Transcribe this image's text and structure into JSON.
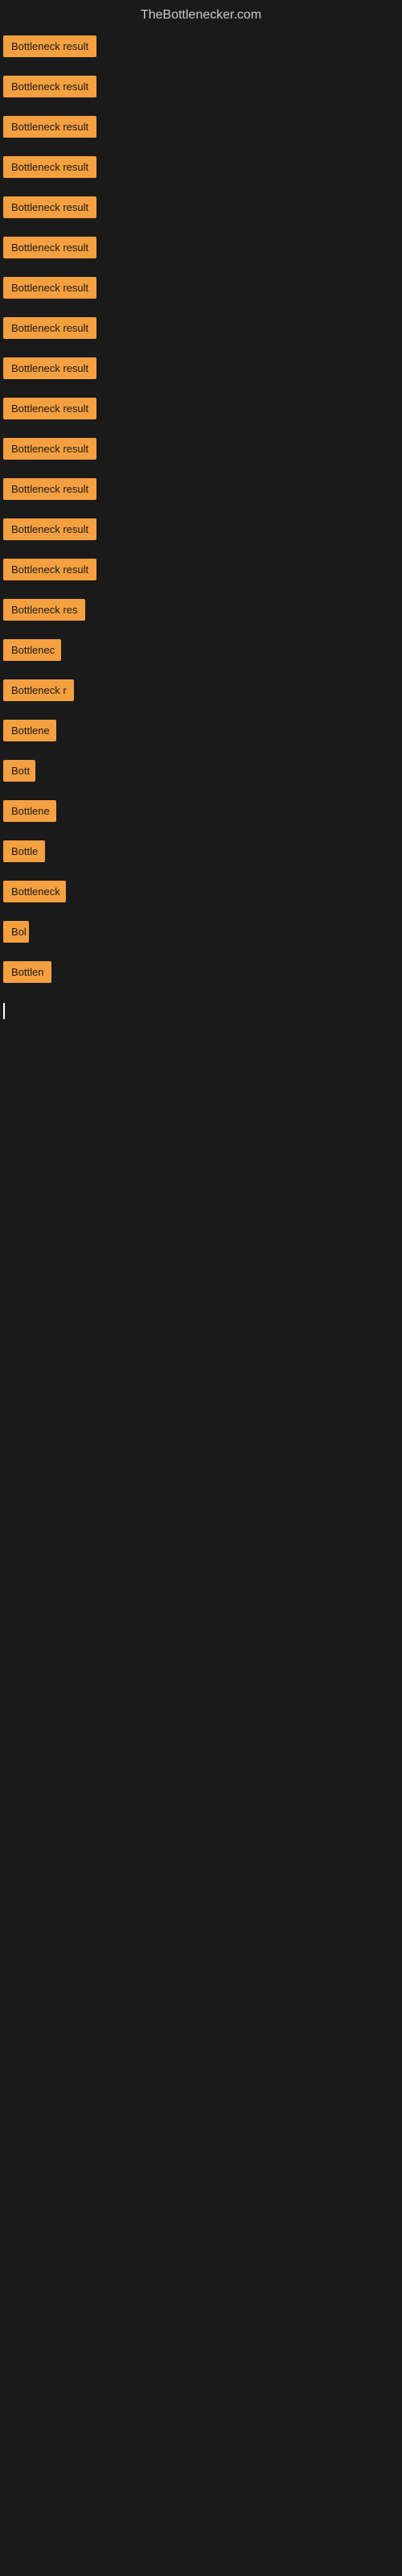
{
  "site": {
    "title": "TheBottlenecker.com"
  },
  "items": [
    {
      "id": 1,
      "label": "Bottleneck result",
      "width": 130
    },
    {
      "id": 2,
      "label": "Bottleneck result",
      "width": 130
    },
    {
      "id": 3,
      "label": "Bottleneck result",
      "width": 130
    },
    {
      "id": 4,
      "label": "Bottleneck result",
      "width": 130
    },
    {
      "id": 5,
      "label": "Bottleneck result",
      "width": 130
    },
    {
      "id": 6,
      "label": "Bottleneck result",
      "width": 130
    },
    {
      "id": 7,
      "label": "Bottleneck result",
      "width": 130
    },
    {
      "id": 8,
      "label": "Bottleneck result",
      "width": 130
    },
    {
      "id": 9,
      "label": "Bottleneck result",
      "width": 130
    },
    {
      "id": 10,
      "label": "Bottleneck result",
      "width": 130
    },
    {
      "id": 11,
      "label": "Bottleneck result",
      "width": 130
    },
    {
      "id": 12,
      "label": "Bottleneck result",
      "width": 130
    },
    {
      "id": 13,
      "label": "Bottleneck result",
      "width": 130
    },
    {
      "id": 14,
      "label": "Bottleneck result",
      "width": 130
    },
    {
      "id": 15,
      "label": "Bottleneck res",
      "width": 105
    },
    {
      "id": 16,
      "label": "Bottlenec",
      "width": 72
    },
    {
      "id": 17,
      "label": "Bottleneck r",
      "width": 88
    },
    {
      "id": 18,
      "label": "Bottlene",
      "width": 66
    },
    {
      "id": 19,
      "label": "Bott",
      "width": 40
    },
    {
      "id": 20,
      "label": "Bottlene",
      "width": 66
    },
    {
      "id": 21,
      "label": "Bottle",
      "width": 52
    },
    {
      "id": 22,
      "label": "Bottleneck",
      "width": 78
    },
    {
      "id": 23,
      "label": "Bol",
      "width": 32
    },
    {
      "id": 24,
      "label": "Bottlen",
      "width": 60
    }
  ]
}
